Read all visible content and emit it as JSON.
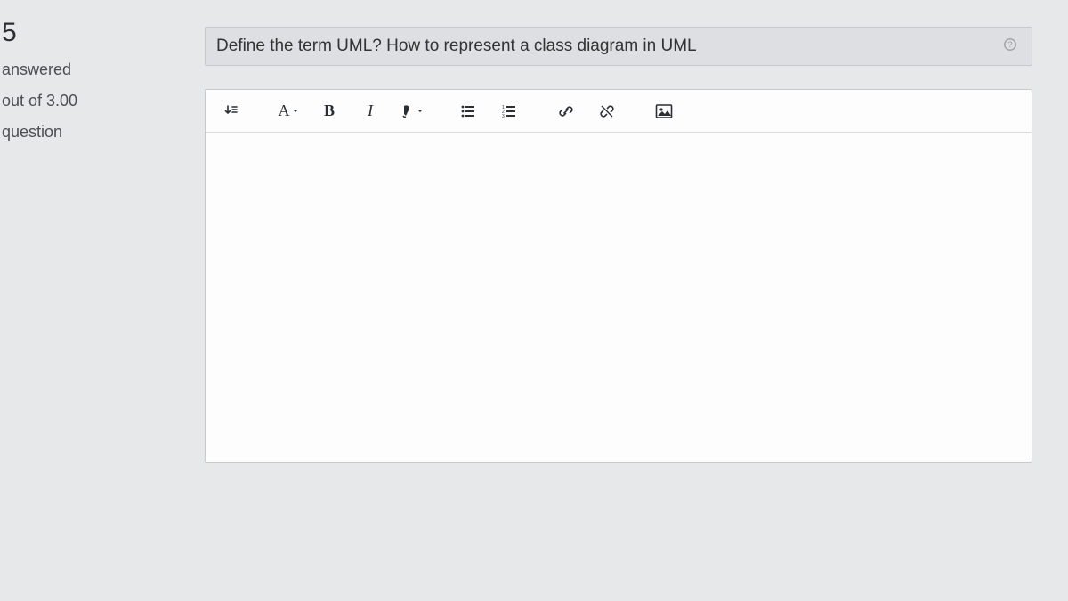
{
  "sidebar": {
    "number": "5",
    "status": "answered",
    "marks": "out of 3.00",
    "flag": "question"
  },
  "question": {
    "text": "Define the term UML? How to represent a class diagram in UML"
  },
  "toolbar": {
    "paragraph": "¶",
    "font_label": "A",
    "bold": "B",
    "italic": "I"
  }
}
